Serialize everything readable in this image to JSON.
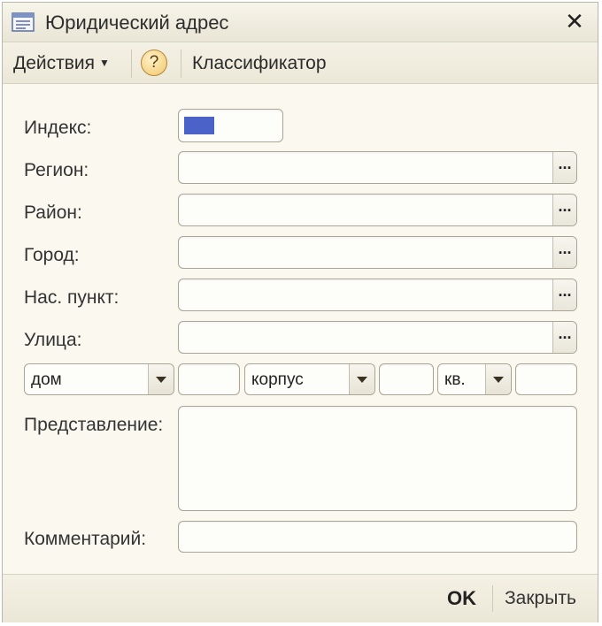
{
  "window": {
    "title": "Юридический адрес",
    "close_symbol": "✕"
  },
  "toolbar": {
    "actions_label": "Действия",
    "help_symbol": "?",
    "classifier_label": "Классификатор"
  },
  "form": {
    "index": {
      "label": "Индекс:",
      "value": ""
    },
    "region": {
      "label": "Регион:",
      "value": "",
      "button": "..."
    },
    "district": {
      "label": "Район:",
      "value": "",
      "button": "..."
    },
    "city": {
      "label": "Город:",
      "value": "",
      "button": "..."
    },
    "settlement": {
      "label": "Нас. пункт:",
      "value": "",
      "button": "..."
    },
    "street": {
      "label": "Улица:",
      "value": "",
      "button": "..."
    },
    "house_type": {
      "selected": "дом",
      "value": ""
    },
    "building_type": {
      "selected": "корпус",
      "value": ""
    },
    "apartment_type": {
      "selected": "кв.",
      "value": ""
    },
    "representation": {
      "label": "Представление:",
      "value": ""
    },
    "comment": {
      "label": "Комментарий:",
      "value": ""
    }
  },
  "footer": {
    "ok_label": "OK",
    "close_label": "Закрыть"
  },
  "colors": {
    "window_bg": "#fbf9ef",
    "index_highlight": "#4b63c9",
    "help_button": "#f2c66a"
  }
}
